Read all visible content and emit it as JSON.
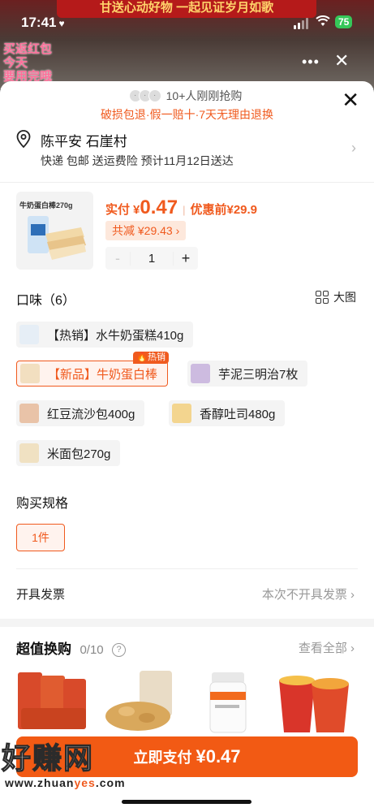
{
  "status_bar": {
    "time": "17:41",
    "battery": "75"
  },
  "backdrop": {
    "banner": "甘送心动好物 一起见证岁月如歌",
    "overlay_text": [
      "买返红包",
      "今天",
      "要用完哦"
    ]
  },
  "sheet": {
    "buyers_text": "10+人刚刚抢购",
    "guarantee_text": "破损包退·假一赔十·7天无理由退换",
    "address": {
      "name": "陈平安 石崖村",
      "shipping": "快递 包邮 送运费险 预计11月12日送达"
    },
    "product": {
      "thumb_title": "牛奶蛋白棒270g",
      "pay_label": "实付",
      "currency": "¥",
      "price": "0.47",
      "before_label": "优惠前",
      "before_price": "¥29.9",
      "discount_label": "共减",
      "discount_amount": "¥29.43",
      "quantity": "1",
      "minus": "-",
      "plus": "+"
    },
    "flavor": {
      "title": "口味（6）",
      "big_view": "大图",
      "options": [
        {
          "label": "【热销】水牛奶蛋糕410g"
        },
        {
          "label": "【新品】牛奶蛋白棒",
          "tag": "热销",
          "selected": true
        },
        {
          "label": "芋泥三明治7枚"
        },
        {
          "label": "红豆流沙包400g"
        },
        {
          "label": "香醇吐司480g"
        },
        {
          "label": "米面包270g"
        }
      ]
    },
    "spec": {
      "title": "购买规格",
      "option": "1件"
    },
    "invoice": {
      "label": "开具发票",
      "value": "本次不开具发票"
    },
    "exchange": {
      "title": "超值换购",
      "count": "0/10",
      "help": "?",
      "view_all": "查看全部"
    },
    "pay_button": {
      "label": "立即支付",
      "amount": "¥0.47"
    },
    "watermark": {
      "big": "好赚网",
      "url_a": "www.zhuan",
      "url_em": "yes",
      "url_b": ".com"
    }
  }
}
